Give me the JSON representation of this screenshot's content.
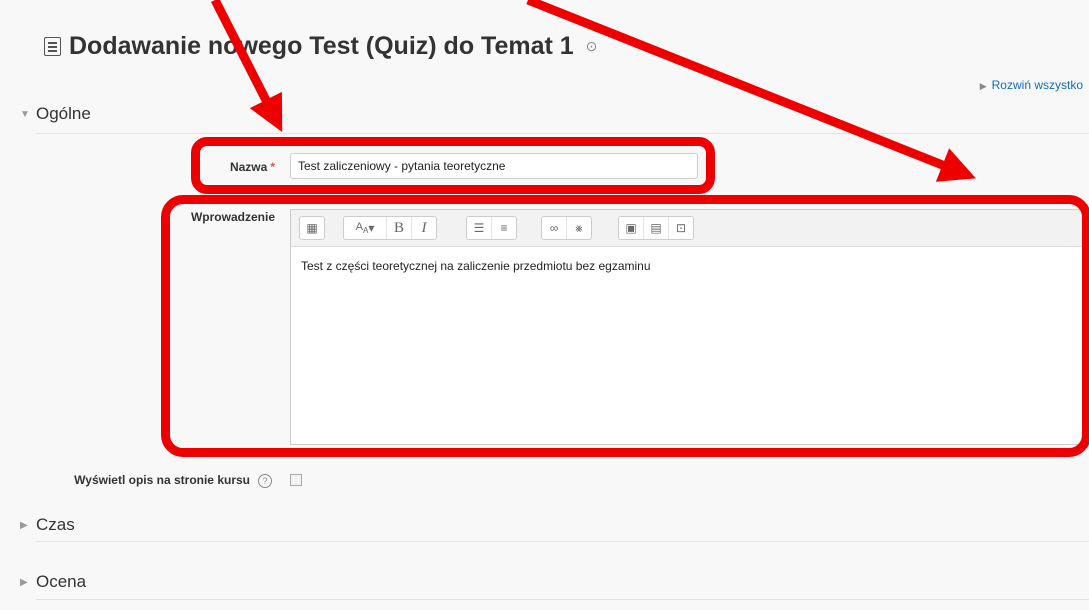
{
  "page": {
    "title": "Dodawanie nowego Test (Quiz) do Temat 1",
    "help_icon": "question-circle-icon",
    "expand_all": "Rozwiń wszystko"
  },
  "sections": {
    "general": "Ogólne",
    "time": "Czas",
    "grade": "Ocena"
  },
  "form": {
    "name_label": "Nazwa",
    "required_mark": "*",
    "name_value": "Test zaliczeniowy - pytania teoretyczne",
    "intro_label": "Wprowadzenie",
    "intro_text": "Test z części teoretycznej na zaliczenie przedmiotu bez egzaminu",
    "show_desc_label": "Wyświetl opis na stronie kursu",
    "show_desc_checked": false
  },
  "toolbar": {
    "buttons": [
      "toggle-toolbar-icon",
      "font-style-icon",
      "bold-icon",
      "italic-icon",
      "unordered-list-icon",
      "ordered-list-icon",
      "link-icon",
      "unlink-icon",
      "image-icon",
      "media-icon",
      "file-manage-icon"
    ],
    "bold": "B",
    "italic": "I"
  },
  "annotation": {
    "color": "#ee0000"
  }
}
